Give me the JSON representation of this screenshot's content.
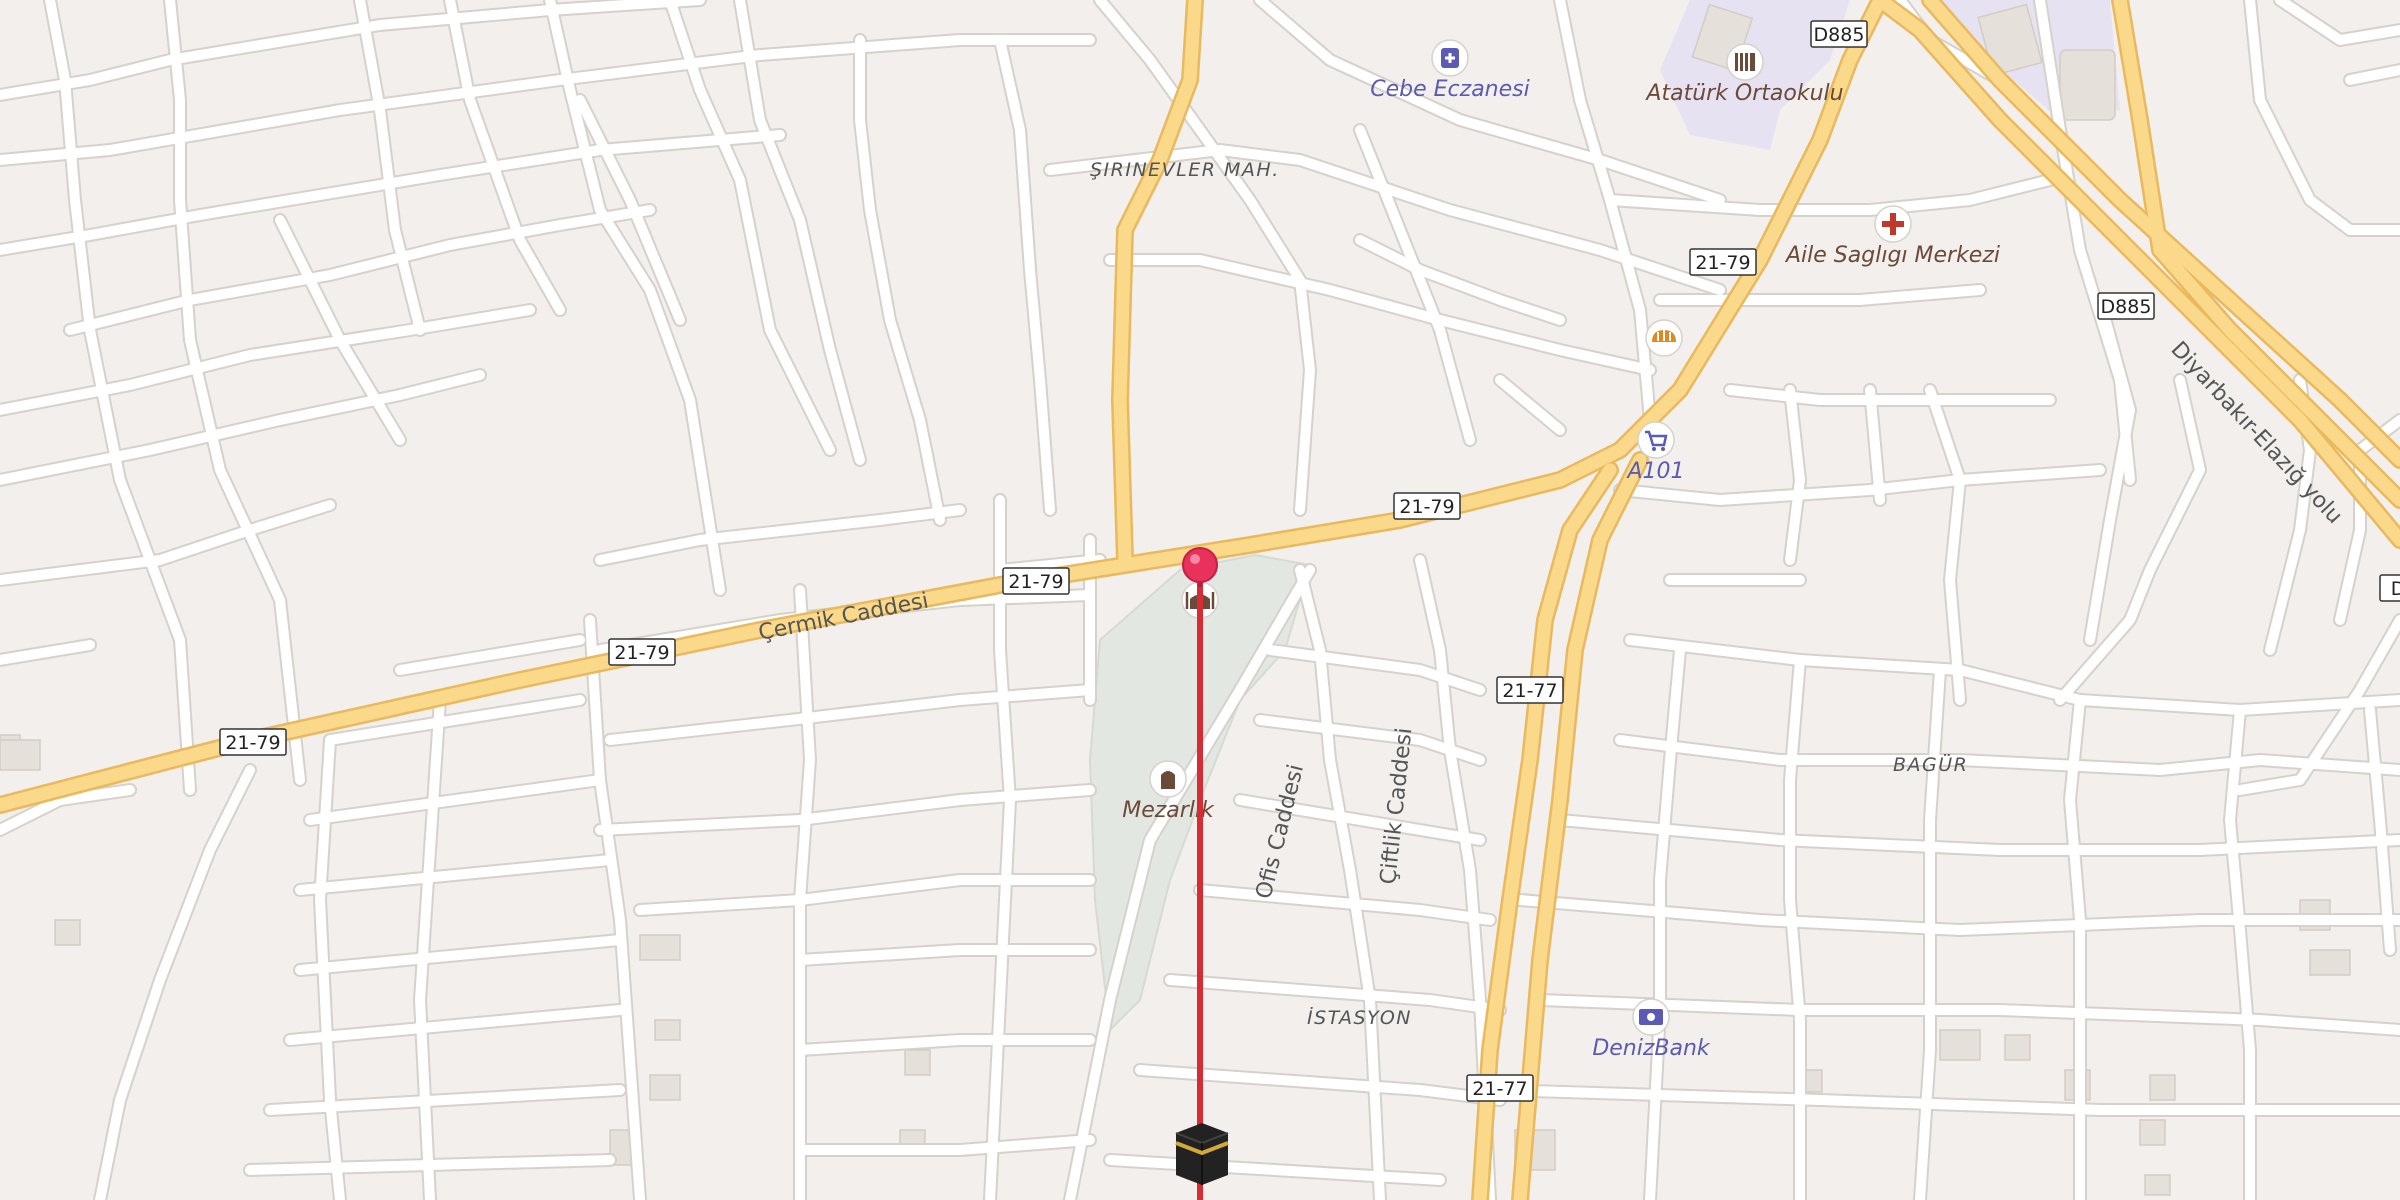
{
  "map": {
    "pois": [
      {
        "name": "Cebe Eczanesi",
        "icon": "pharmacy-icon",
        "color": "#5b5bb5"
      },
      {
        "name": "Atatürk Ortaokulu",
        "icon": "school-icon",
        "color": "#6b4a3a"
      },
      {
        "name": "Aile Saglıgı Merkezi",
        "icon": "clinic-icon",
        "color": "#c0392b"
      },
      {
        "name": "A101",
        "icon": "shopping-cart-icon",
        "color": "#5b5bb5"
      },
      {
        "name": "Mezarlık",
        "icon": "cemetery-icon",
        "color": "#6b4a3a"
      },
      {
        "name": "DenizBank",
        "icon": "bank-icon",
        "color": "#5b5bb5"
      },
      {
        "name": "",
        "icon": "bakery-icon",
        "color": "#e08a1e"
      },
      {
        "name": "",
        "icon": "mosque-icon",
        "color": "#6b4a3a"
      }
    ],
    "districts": [
      "ŞIRINEVLER MAH.",
      "BAGÜR",
      "İSTASYON"
    ],
    "streets": [
      "Çermik Caddesi",
      "Ofis Caddesi",
      "Çiftlik Caddesi",
      "Diyarbakır-Elazığ yolu"
    ],
    "route_shields": [
      "21-79",
      "21-79",
      "21-79",
      "21-79",
      "21-79",
      "21-77",
      "21-77",
      "D885",
      "D885",
      "D"
    ],
    "colors": {
      "background": "#f2efec",
      "road_major": "#fbd98a",
      "road_major_casing": "#e9b95f",
      "road_minor": "#ffffff",
      "road_minor_casing": "#d6d1cb",
      "cemetery": "#e3e7e1",
      "school_area": "#e7e2f2",
      "qibla_line": "#d62c36",
      "pin": "#e8315b"
    },
    "markers": {
      "pin": "location-pin-icon",
      "kaaba": "kaaba-icon"
    }
  }
}
